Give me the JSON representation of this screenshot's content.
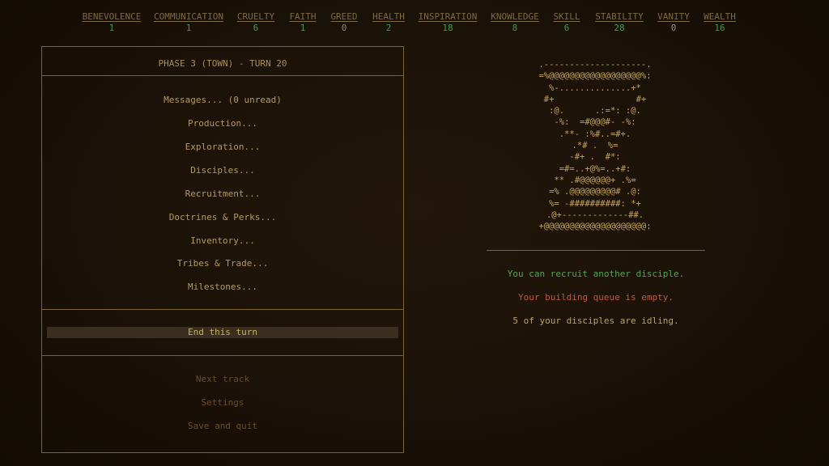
{
  "stats": [
    {
      "name": "BENEVOLENCE",
      "value": "1",
      "color": "#3f9a47"
    },
    {
      "name": "COMMUNICATION",
      "value": "1",
      "color": "#3f9a47"
    },
    {
      "name": "CRUELTY",
      "value": "6",
      "color": "#3f9a47"
    },
    {
      "name": "FAITH",
      "value": "1",
      "color": "#3f9a47"
    },
    {
      "name": "GREED",
      "value": "0",
      "color": "#8a8a7a"
    },
    {
      "name": "HEALTH",
      "value": "2",
      "color": "#3f9a47"
    },
    {
      "name": "INSPIRATION",
      "value": "18",
      "color": "#3f9a47"
    },
    {
      "name": "KNOWLEDGE",
      "value": "8",
      "color": "#3f9a47"
    },
    {
      "name": "SKILL",
      "value": "6",
      "color": "#3f9a47"
    },
    {
      "name": "STABILITY",
      "value": "28",
      "color": "#3f9a47"
    },
    {
      "name": "VANITY",
      "value": "0",
      "color": "#8a8a7a"
    },
    {
      "name": "WEALTH",
      "value": "16",
      "color": "#3f9a47"
    }
  ],
  "panel": {
    "title": "PHASE 3 (TOWN) - TURN 20",
    "menu": [
      "Messages... (0 unread)",
      "Production...",
      "Exploration...",
      "Disciples...",
      "Recruitment...",
      "Doctrines & Perks...",
      "Inventory...",
      "Tribes & Trade...",
      "Milestones..."
    ],
    "end_turn": "End this turn",
    "system": [
      "Next track",
      "Settings",
      "Save and quit"
    ]
  },
  "art": ".--------------------.\n=%@@@@@@@@@@@@@@@@@@%:\n%-..............+*\n#+                #+\n:@.      .:=*: :@.\n-%:  =#@@@#- -%:\n.**- :%#..=#+.\n.*# .  %=\n-#+ .  #*:\n=#=..+@%=..+#:\n** .#@@@@@@+ .%=\n=% .@@@@@@@@@# .@:\n%= -##########: *+\n.@+-------------##.\n+@@@@@@@@@@@@@@@@@@@@:",
  "messages": {
    "recruit": "You can recruit another disciple.",
    "queue": "Your building queue is empty.",
    "idle": "5 of your disciples are idling."
  },
  "colors": {
    "positive": "#3f9a47",
    "neutral": "#8a8a7a",
    "warning": "#c05a40",
    "accent": "#c3a45e"
  }
}
